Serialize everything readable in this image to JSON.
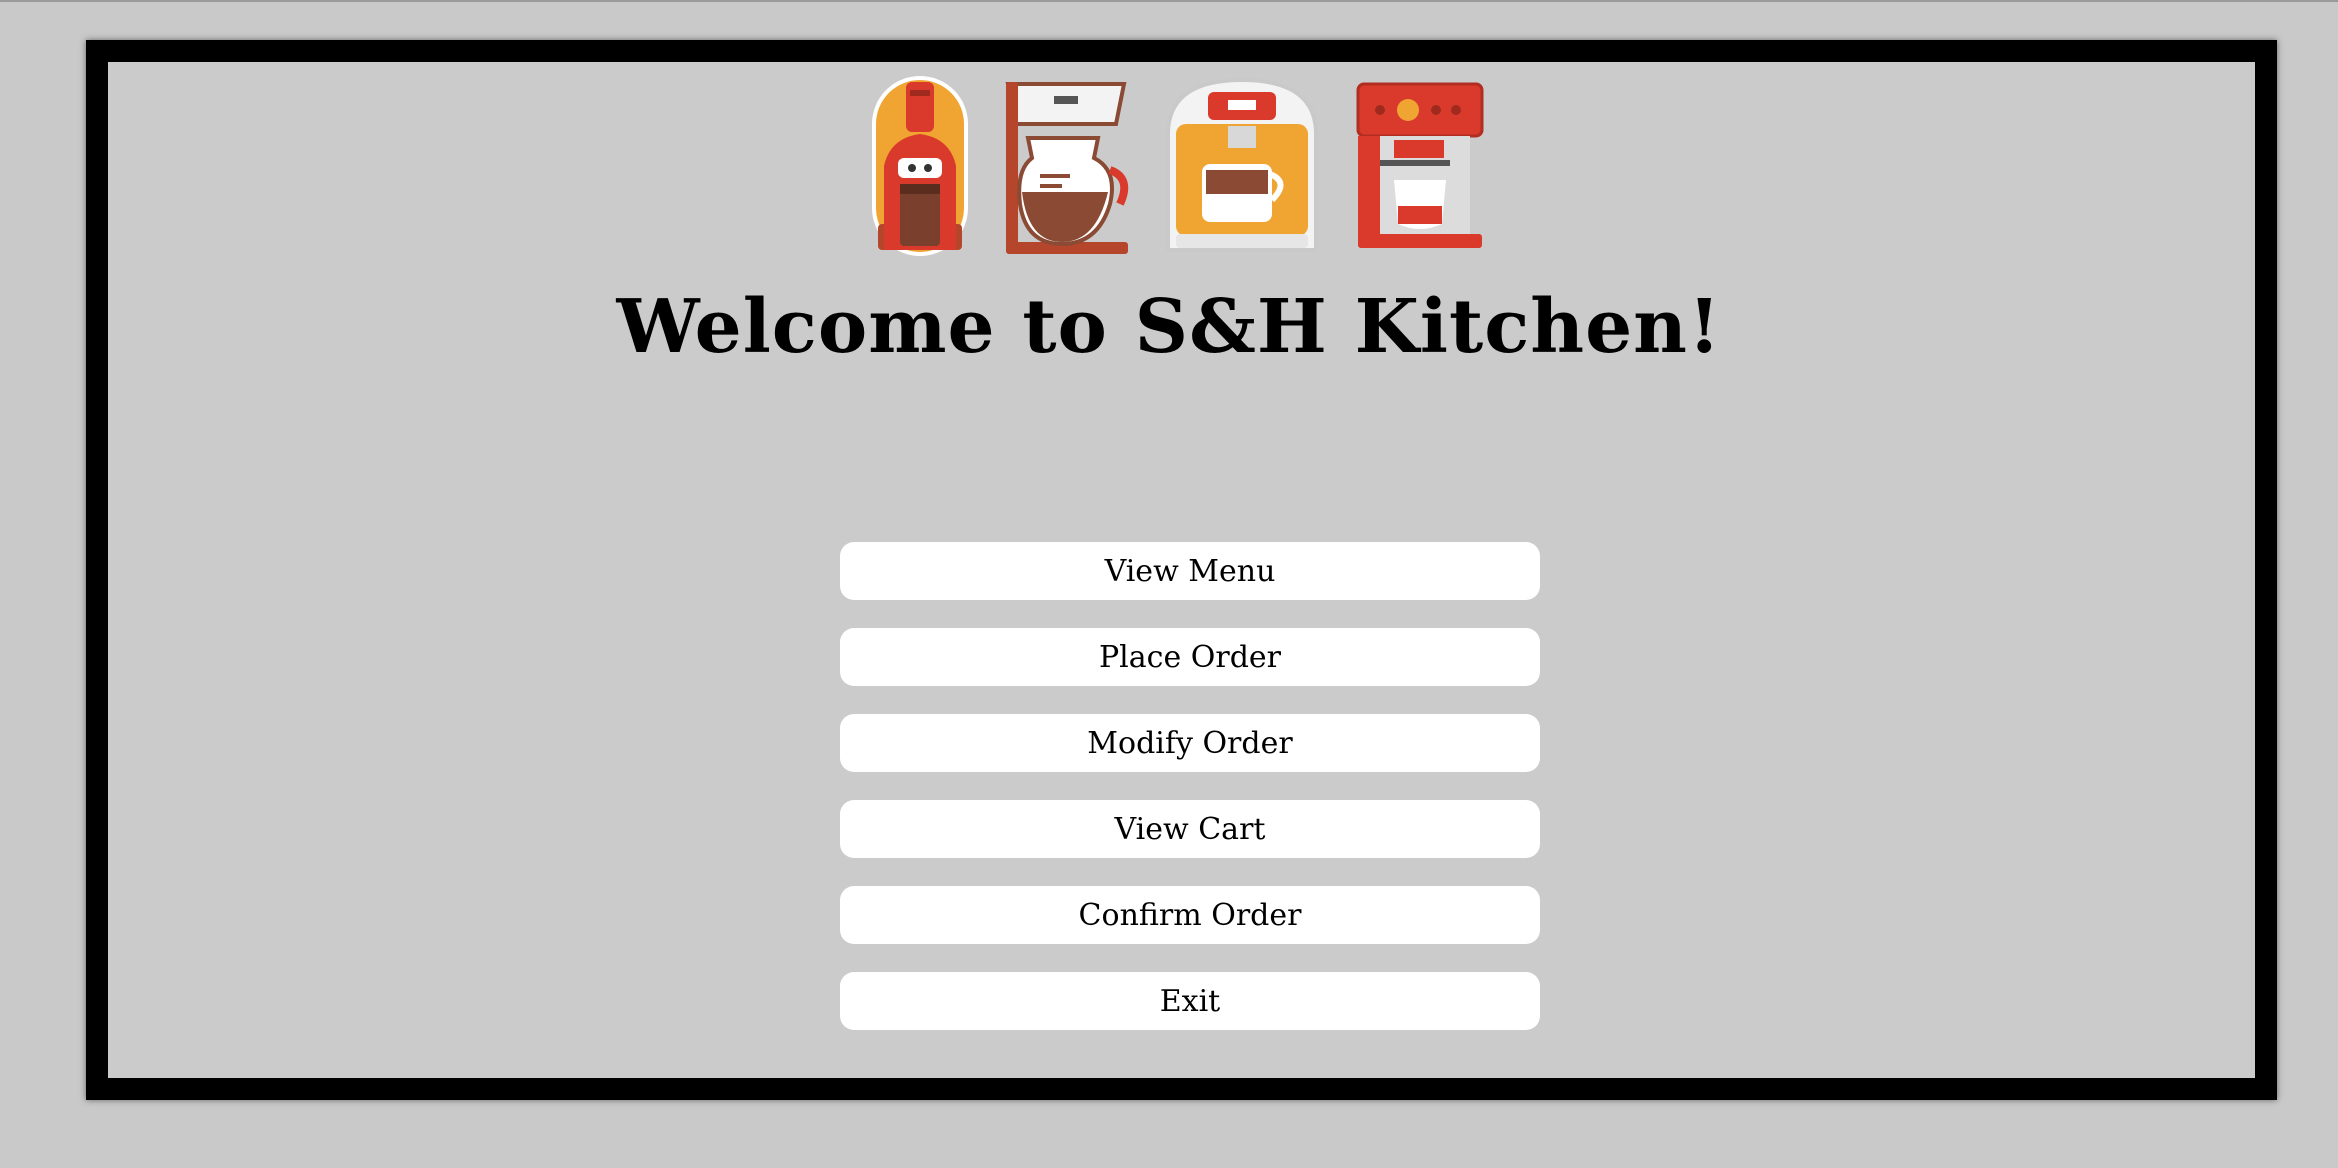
{
  "header": {
    "title": "Welcome to S&H Kitchen!"
  },
  "banner": {
    "icons": [
      "grinder-icon",
      "drip-coffee-maker-icon",
      "capsule-coffee-machine-icon",
      "espresso-machine-icon"
    ]
  },
  "menu": {
    "items": [
      {
        "label": "View Menu"
      },
      {
        "label": "Place Order"
      },
      {
        "label": "Modify Order"
      },
      {
        "label": "View Cart"
      },
      {
        "label": "Confirm Order"
      },
      {
        "label": "Exit"
      }
    ]
  },
  "colors": {
    "background": "#cbcbcb",
    "frame": "#000000",
    "button": "#ffffff",
    "accent_red": "#d93a2b",
    "accent_orange": "#f0a432",
    "coffee_brown": "#8a4a34"
  }
}
